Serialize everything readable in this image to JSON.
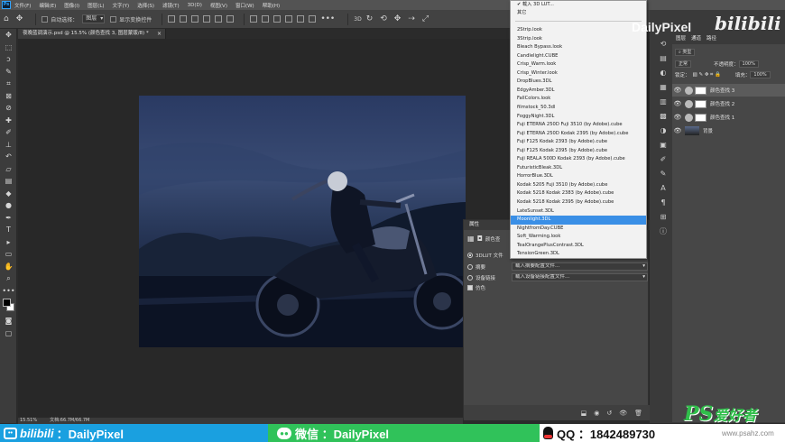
{
  "menubar": {
    "logo": "Ps",
    "items": [
      "文件(F)",
      "编辑(E)",
      "图像(I)",
      "图层(L)",
      "文字(Y)",
      "选择(S)",
      "滤镜(T)",
      "3D(D)",
      "视图(V)",
      "窗口(W)",
      "帮助(H)"
    ]
  },
  "options": {
    "auto_select_label": "自动选择：",
    "auto_select_value": "图层",
    "show_transform_label": "显示变换控件"
  },
  "document": {
    "tab_title": "夜晚蓝调演示.psd @ 15.5% (颜色查找 3, 图层蒙版/8) *",
    "close": "×",
    "zoom": "15.51%",
    "doc_size": "文档:66.7M/66.7M"
  },
  "properties": {
    "tab": "属性",
    "header": "颜色查",
    "lut_label": "3DLUT 文件",
    "abstract_label": "摘要",
    "abstract_value": "载入摘要配置文件...",
    "devicelink_label": "设备链接",
    "devicelink_value": "载入设备链接配置文件...",
    "dither_label": "仿色"
  },
  "lut_dropdown": {
    "load_item": "✔ 载入 3D LUT...",
    "other_item": "其它",
    "selected": "Moonlight.3DL",
    "items": [
      "2Strip.look",
      "3Strip.look",
      "Bleach Bypass.look",
      "Candlelight.CUBE",
      "Crisp_Warm.look",
      "Crisp_Winter.look",
      "DropBlues.3DL",
      "EdgyAmber.3DL",
      "FallColors.look",
      "filmstock_50.3dl",
      "FoggyNight.3DL",
      "Fuji ETERNA 250D Fuji 3510 (by Adobe).cube",
      "Fuji ETERNA 250D Kodak 2395 (by Adobe).cube",
      "Fuji F125 Kodak 2393 (by Adobe).cube",
      "Fuji F125 Kodak 2395 (by Adobe).cube",
      "Fuji REALA 500D Kodak 2393 (by Adobe).cube",
      "FuturisticBleak.3DL",
      "HorrorBlue.3DL",
      "Kodak 5205 Fuji 3510 (by Adobe).cube",
      "Kodak 5218 Kodak 2383 (by Adobe).cube",
      "Kodak 5218 Kodak 2395 (by Adobe).cube",
      "LateSunset.3DL",
      "Moonlight.3DL",
      "NightfromDay.CUBE",
      "Soft_Warming.look",
      "TealOrangePlusContrast.3DL",
      "TensionGreen.3DL"
    ]
  },
  "layers": {
    "tabs": [
      "图层",
      "通道",
      "路径"
    ],
    "kind_label": "类型",
    "blend_mode": "正常",
    "opacity_label": "不透明度：",
    "opacity_value": "100%",
    "lock_label": "锁定：",
    "fill_label": "填充：",
    "fill_value": "100%",
    "list": [
      {
        "name": "颜色查找 3",
        "active": true
      },
      {
        "name": "颜色查找 2",
        "active": false
      },
      {
        "name": "颜色查找 1",
        "active": false
      },
      {
        "name": "背景",
        "active": false
      }
    ]
  },
  "watermark": {
    "bili_name": "DailyPixel",
    "bili_logo": "bilibili"
  },
  "banner": {
    "bili_text": "：DailyPixel",
    "bili_logo": "bilibili",
    "wechat_text": "微信 ：DailyPixel",
    "qq_text": "QQ ：1842489730",
    "ps_logo": "PS",
    "ps_logo_zh": "爱好者",
    "ps_url": "www.psahz.com"
  },
  "colors": {
    "dropdown_highlight": "#3a8fe6",
    "banner_blue": "#1aa0e0",
    "banner_green": "#30c25a"
  }
}
